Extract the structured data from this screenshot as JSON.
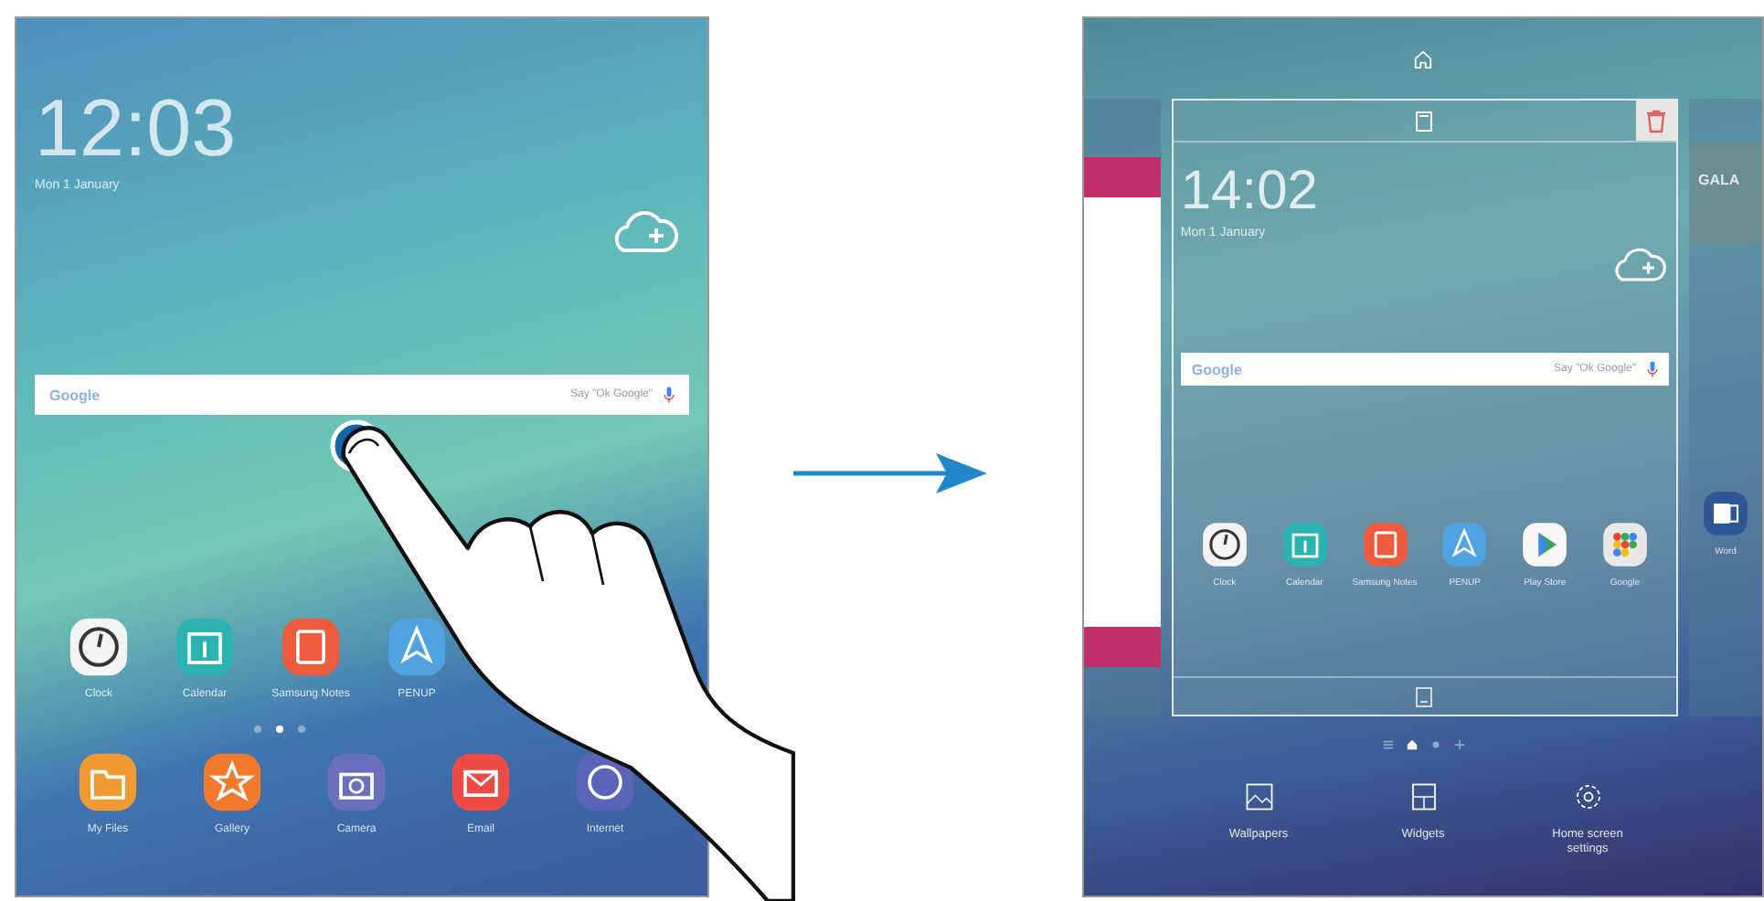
{
  "before": {
    "clock": "12:03",
    "date": "Mon 1 January",
    "search": {
      "logo": "Google",
      "hint": "Say \"Ok Google\""
    },
    "apps": [
      {
        "label": "Clock",
        "kind": "clock"
      },
      {
        "label": "Calendar",
        "kind": "calendar"
      },
      {
        "label": "Samsung Notes",
        "kind": "notes"
      },
      {
        "label": "PENUP",
        "kind": "penup"
      }
    ],
    "pages": [
      {
        "selected": false
      },
      {
        "selected": true
      },
      {
        "selected": false
      }
    ],
    "dock": [
      {
        "label": "My Files",
        "kind": "folder"
      },
      {
        "label": "Gallery",
        "kind": "gallery"
      },
      {
        "label": "Camera",
        "kind": "camera"
      },
      {
        "label": "Email",
        "kind": "email"
      },
      {
        "label": "Internet",
        "kind": "internet"
      }
    ]
  },
  "after": {
    "clock": "14:02",
    "date": "Mon 1 January",
    "search": {
      "logo": "Google",
      "hint": "Say \"Ok Google\""
    },
    "apps": [
      {
        "label": "Clock",
        "kind": "clock"
      },
      {
        "label": "Calendar",
        "kind": "calendar"
      },
      {
        "label": "Samsung Notes",
        "kind": "notes"
      },
      {
        "label": "PENUP",
        "kind": "penup"
      },
      {
        "label": "Play Store",
        "kind": "play"
      },
      {
        "label": "Google",
        "kind": "gfolder"
      }
    ],
    "next_page": {
      "title": "GALA",
      "app": {
        "label": "Word",
        "kind": "word"
      }
    },
    "pages": [
      {
        "kind": "list",
        "selected": false
      },
      {
        "kind": "home",
        "selected": true
      },
      {
        "kind": "dot",
        "selected": false
      },
      {
        "kind": "add",
        "selected": false
      }
    ],
    "options": [
      {
        "label": "Wallpapers",
        "kind": "wallpaper"
      },
      {
        "label": "Widgets",
        "kind": "widgets"
      },
      {
        "label": "Home screen settings",
        "kind": "settings"
      }
    ]
  }
}
